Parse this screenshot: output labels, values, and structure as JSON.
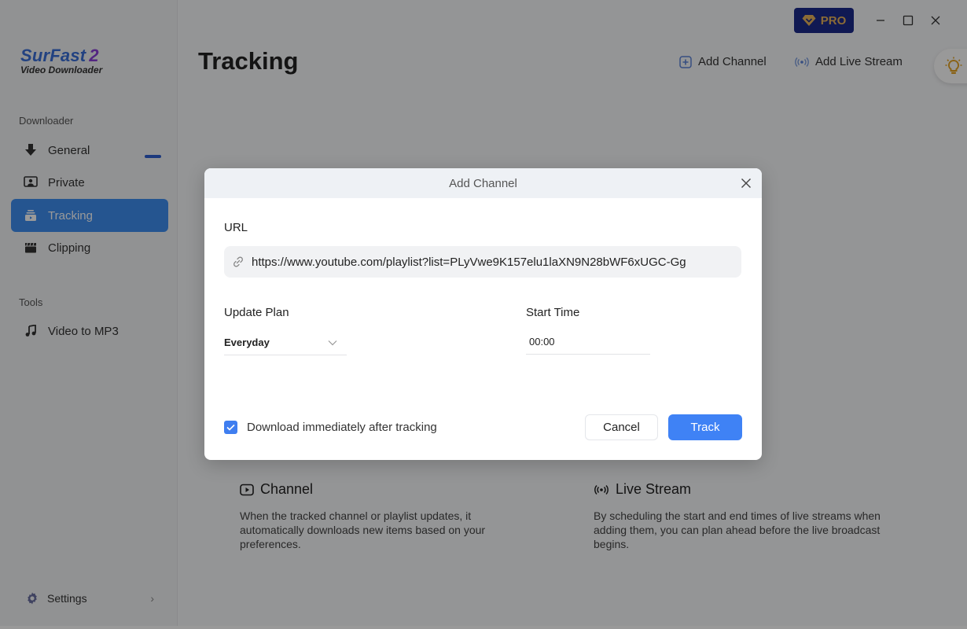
{
  "app": {
    "brand_name": "SurFast",
    "brand_version": "2",
    "brand_subtitle": "Video Downloader",
    "pro_label": "PRO"
  },
  "sidebar": {
    "sections": [
      {
        "label": "Downloader",
        "items": [
          {
            "label": "General",
            "icon": "download-icon"
          },
          {
            "label": "Private",
            "icon": "private-icon"
          },
          {
            "label": "Tracking",
            "icon": "tracking-icon",
            "active": true
          },
          {
            "label": "Clipping",
            "icon": "clapperboard-icon"
          }
        ]
      },
      {
        "label": "Tools",
        "items": [
          {
            "label": "Video to MP3",
            "icon": "music-note-icon"
          }
        ]
      }
    ],
    "settings_label": "Settings"
  },
  "header": {
    "title": "Tracking",
    "add_channel_label": "Add Channel",
    "add_live_stream_label": "Add Live Stream"
  },
  "info": {
    "channel": {
      "title": "Channel",
      "description": "When the tracked channel or playlist updates, it automatically downloads new items based on your preferences."
    },
    "live_stream": {
      "title": "Live Stream",
      "description": "By scheduling the start and end times of live streams when adding them, you can plan ahead before the live broadcast begins."
    }
  },
  "dialog": {
    "title": "Add Channel",
    "url_label": "URL",
    "url_value": "https://www.youtube.com/playlist?list=PLyVwe9K157elu1laXN9N28bWF6xUGC-Gg",
    "update_plan_label": "Update Plan",
    "update_plan_value": "Everyday",
    "start_time_label": "Start Time",
    "start_time_value": "00:00",
    "download_immediately_label": "Download immediately after tracking",
    "download_immediately_checked": true,
    "cancel_label": "Cancel",
    "track_label": "Track"
  },
  "colors": {
    "accent": "#3f82f5",
    "sidebar_active": "#3f8ef0",
    "pro_bg": "#1b2a8a",
    "pro_fg": "#e8b35a"
  }
}
